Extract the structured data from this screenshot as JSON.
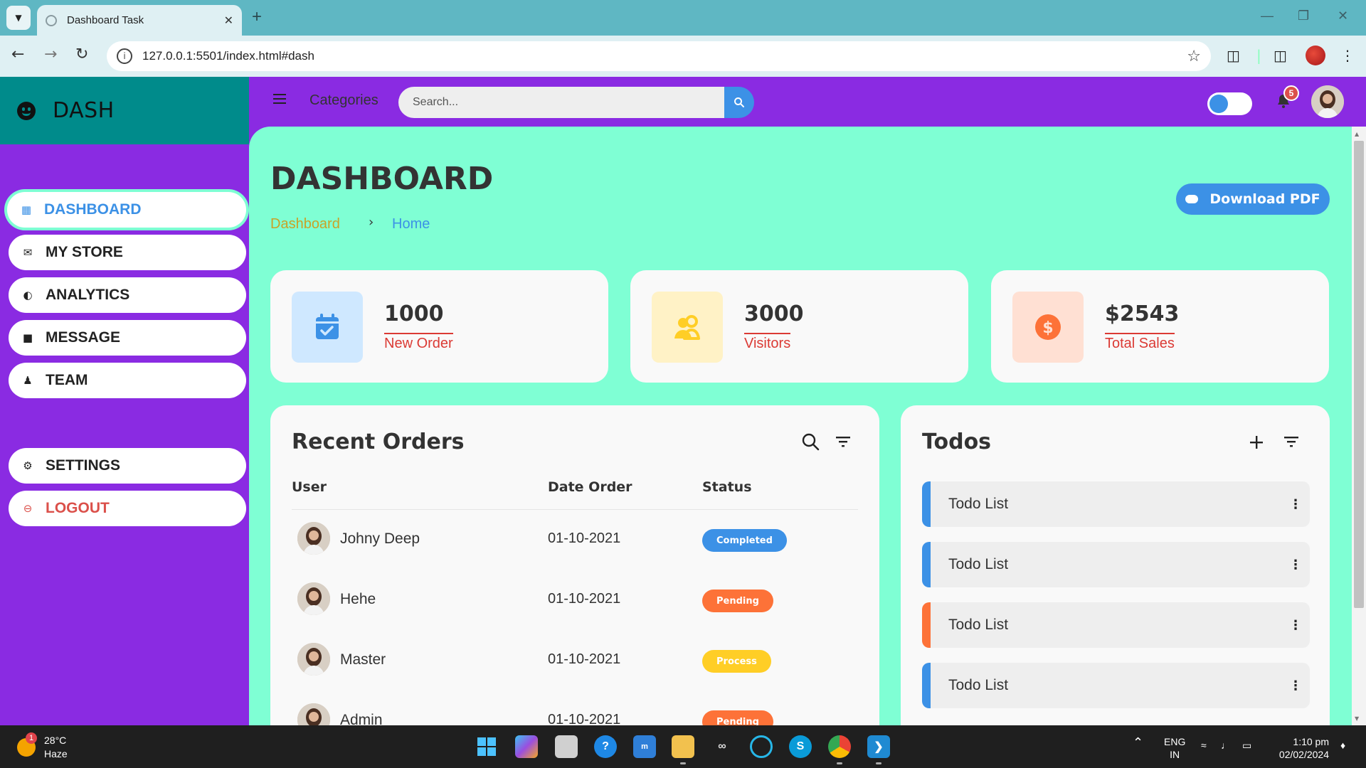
{
  "browser": {
    "tab_title": "Dashboard Task",
    "url": "127.0.0.1:5501/index.html#dash"
  },
  "sidebar": {
    "brand": "DASH",
    "items": [
      {
        "label": "DASHBOARD",
        "icon": "dashboard-icon"
      },
      {
        "label": "MY STORE",
        "icon": "store-icon"
      },
      {
        "label": "ANALYTICS",
        "icon": "analytics-icon"
      },
      {
        "label": "MESSAGE",
        "icon": "message-icon"
      },
      {
        "label": "TEAM",
        "icon": "team-icon"
      }
    ],
    "bottom_items": [
      {
        "label": "SETTINGS",
        "icon": "gear-icon"
      },
      {
        "label": "LOGOUT",
        "icon": "logout-icon"
      }
    ]
  },
  "topbar": {
    "categories": "Categories",
    "search_placeholder": "Search...",
    "notification_count": "5"
  },
  "main": {
    "title": "DASHBOARD",
    "breadcrumb": [
      "Dashboard",
      "Home"
    ],
    "download_label": "Download PDF",
    "stats": [
      {
        "value": "1000",
        "label": "New Order",
        "icon": "calendar-check-icon",
        "bg": "#cfe8ff",
        "color": "#3c91e6"
      },
      {
        "value": "3000",
        "label": "Visitors",
        "icon": "group-icon",
        "bg": "#fff2c6",
        "color": "#ffce26"
      },
      {
        "value": "$2543",
        "label": "Total Sales",
        "icon": "dollar-circle-icon",
        "bg": "#ffe0d3",
        "color": "#fd7238"
      }
    ],
    "orders": {
      "title": "Recent Orders",
      "columns": [
        "User",
        "Date Order",
        "Status"
      ],
      "rows": [
        {
          "user": "Johny Deep",
          "date": "01-10-2021",
          "status": "Completed",
          "status_color": "#3c91e6"
        },
        {
          "user": "Hehe",
          "date": "01-10-2021",
          "status": "Pending",
          "status_color": "#fd7238"
        },
        {
          "user": "Master",
          "date": "01-10-2021",
          "status": "Process",
          "status_color": "#ffce26"
        },
        {
          "user": "Admin",
          "date": "01-10-2021",
          "status": "Pending",
          "status_color": "#fd7238"
        }
      ]
    },
    "todos": {
      "title": "Todos",
      "items": [
        {
          "label": "Todo List",
          "state": "blue"
        },
        {
          "label": "Todo List",
          "state": "blue"
        },
        {
          "label": "Todo List",
          "state": "orange"
        },
        {
          "label": "Todo List",
          "state": "blue"
        }
      ]
    }
  },
  "taskbar": {
    "temperature": "28°C",
    "weather": "Haze",
    "weather_badge": "1",
    "lang_1": "ENG",
    "lang_2": "IN",
    "time": "1:10 pm",
    "date": "02/02/2024"
  },
  "colors": {
    "accent": "#3c91e6",
    "sidebar": "#8a2be2",
    "main_bg": "#7fffd4",
    "brand_bg": "#008b8b"
  }
}
